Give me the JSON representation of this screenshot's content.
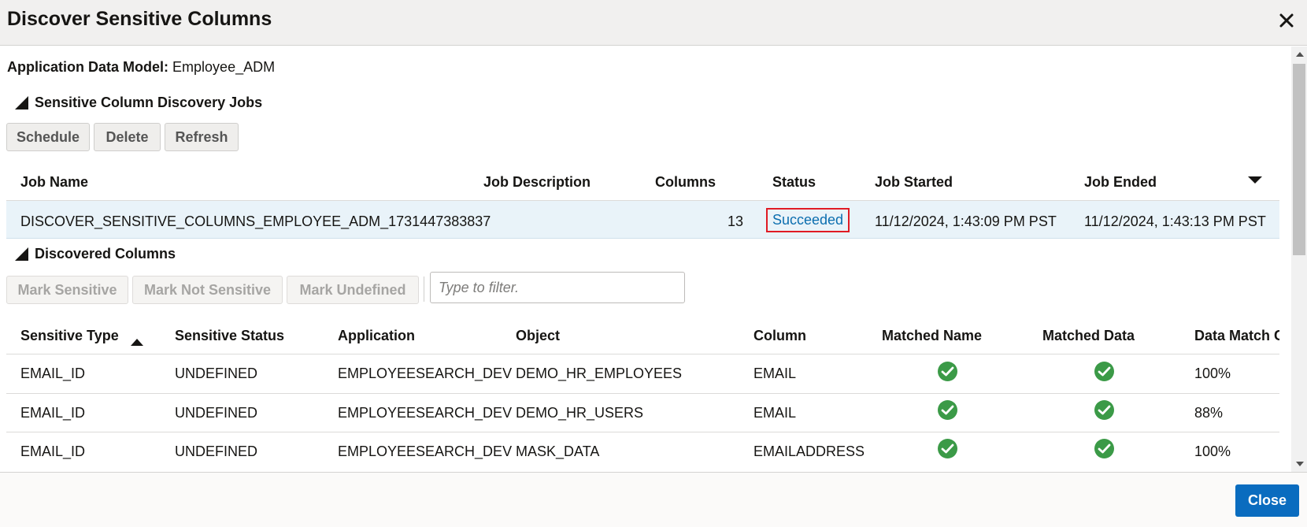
{
  "dialog": {
    "title": "Discover Sensitive Columns",
    "close_button": "Close"
  },
  "adm": {
    "label": "Application Data Model:",
    "value": "Employee_ADM"
  },
  "jobs_section": {
    "title": "Sensitive Column Discovery Jobs",
    "buttons": {
      "schedule": "Schedule",
      "delete": "Delete",
      "refresh": "Refresh"
    },
    "columns": {
      "job_name": "Job Name",
      "job_description": "Job Description",
      "columns": "Columns",
      "status": "Status",
      "job_started": "Job Started",
      "job_ended": "Job Ended"
    },
    "row": {
      "job_name": "DISCOVER_SENSITIVE_COLUMNS_EMPLOYEE_ADM_1731447383837",
      "job_description": "",
      "columns": "13",
      "status": "Succeeded",
      "job_started": "11/12/2024, 1:43:09 PM PST",
      "job_ended": "11/12/2024, 1:43:13 PM PST"
    }
  },
  "discovered_section": {
    "title": "Discovered Columns",
    "buttons": {
      "mark_sensitive": "Mark Sensitive",
      "mark_not_sensitive": "Mark Not Sensitive",
      "mark_undefined": "Mark Undefined"
    },
    "filter_placeholder": "Type to filter.",
    "columns": {
      "sensitive_type": "Sensitive Type",
      "sensitive_status": "Sensitive Status",
      "application": "Application",
      "object": "Object",
      "column": "Column",
      "matched_name": "Matched Name",
      "matched_data": "Matched Data",
      "data_match": "Data Match C"
    },
    "rows": [
      {
        "sensitive_type": "EMAIL_ID",
        "sensitive_status": "UNDEFINED",
        "application": "EMPLOYEESEARCH_DEV",
        "object": "DEMO_HR_EMPLOYEES",
        "column": "EMAIL",
        "matched_name": "check-icon",
        "matched_data": "check-icon",
        "data_match": "100%"
      },
      {
        "sensitive_type": "EMAIL_ID",
        "sensitive_status": "UNDEFINED",
        "application": "EMPLOYEESEARCH_DEV",
        "object": "DEMO_HR_USERS",
        "column": "EMAIL",
        "matched_name": "check-icon",
        "matched_data": "check-icon",
        "data_match": "88%"
      },
      {
        "sensitive_type": "EMAIL_ID",
        "sensitive_status": "UNDEFINED",
        "application": "EMPLOYEESEARCH_DEV",
        "object": "MASK_DATA",
        "column": "EMAILADDRESS",
        "matched_name": "check-icon",
        "matched_data": "check-icon",
        "data_match": "100%"
      }
    ]
  },
  "colors": {
    "header_bg": "#f1f0ef",
    "selected_row_bg": "#e9f3f9",
    "link": "#0b6eaf",
    "highlight_border": "#e01b24",
    "check_green": "#3b9a47",
    "primary_button": "#0a6cbf"
  }
}
